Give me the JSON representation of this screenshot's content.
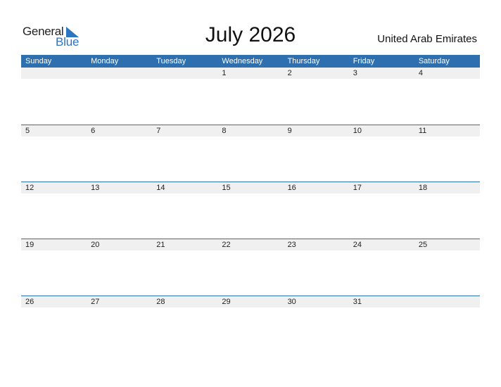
{
  "logo": {
    "general": "General",
    "blue": "Blue"
  },
  "title": "July 2026",
  "country": "United Arab Emirates",
  "colors": {
    "accent": "#2e6fb0",
    "strip": "#f0f0f0"
  },
  "weekdays": [
    "Sunday",
    "Monday",
    "Tuesday",
    "Wednesday",
    "Thursday",
    "Friday",
    "Saturday"
  ],
  "weeks": [
    [
      "",
      "",
      "",
      "1",
      "2",
      "3",
      "4"
    ],
    [
      "5",
      "6",
      "7",
      "8",
      "9",
      "10",
      "11"
    ],
    [
      "12",
      "13",
      "14",
      "15",
      "16",
      "17",
      "18"
    ],
    [
      "19",
      "20",
      "21",
      "22",
      "23",
      "24",
      "25"
    ],
    [
      "26",
      "27",
      "28",
      "29",
      "30",
      "31",
      ""
    ]
  ]
}
